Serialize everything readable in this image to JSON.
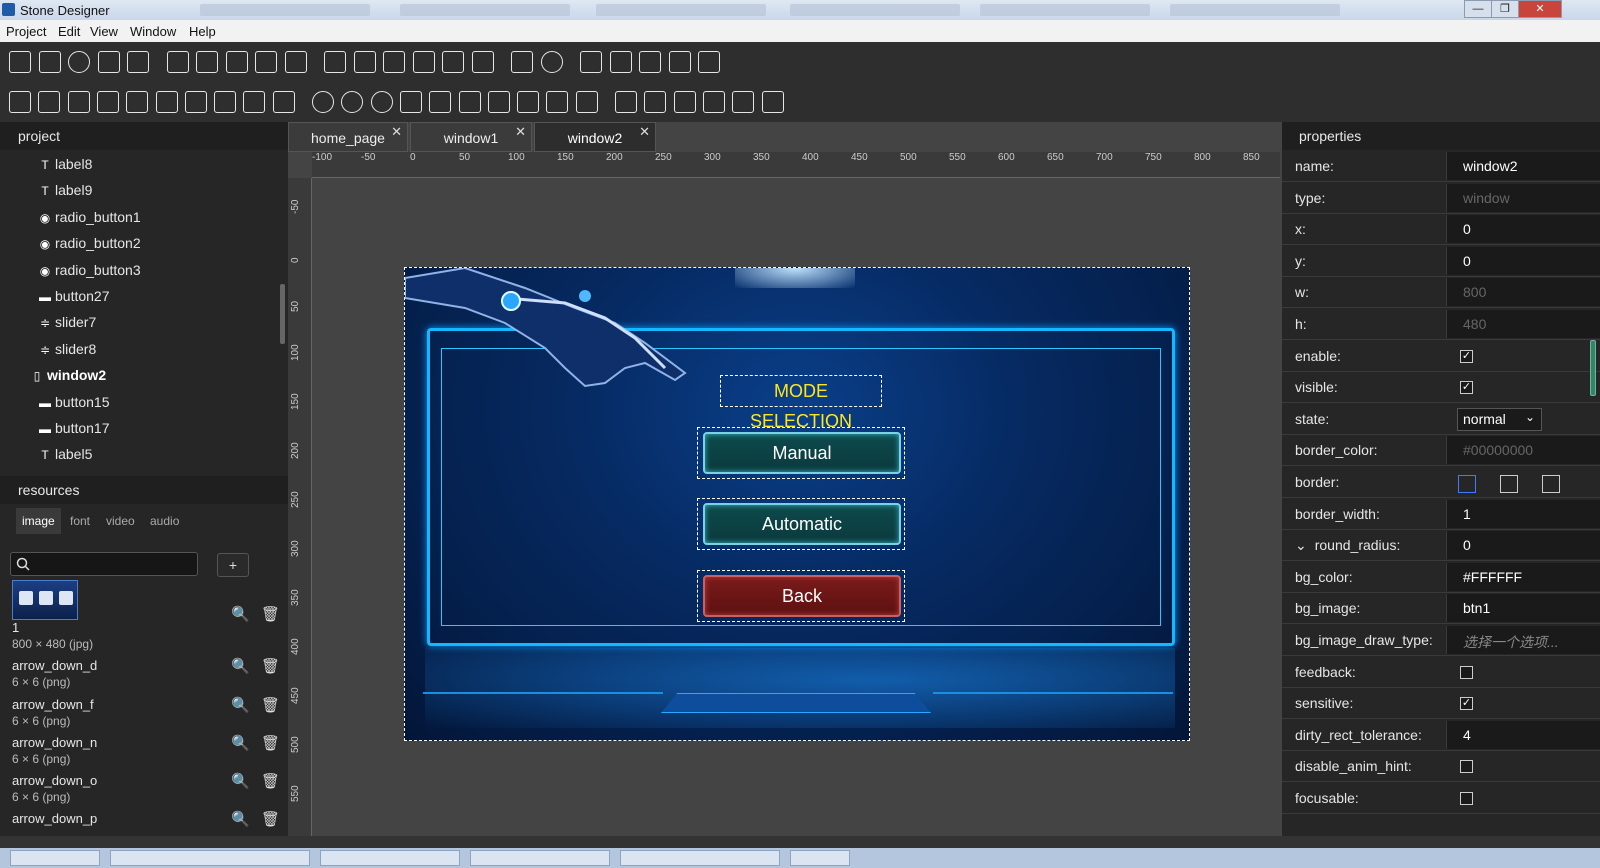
{
  "window": {
    "title": "Stone Designer",
    "close_glyph": "✕",
    "min_glyph": "—",
    "max_glyph": "❐"
  },
  "menu": [
    "Project",
    "Edit",
    "View",
    "Window",
    "Help"
  ],
  "toolbar1_icons": [
    "button-icon",
    "check-icon",
    "radio-icon",
    "switch-icon",
    "list-icon",
    "chart-icon",
    "gif-icon",
    "svg-icon",
    "image-icon",
    "gallery-icon",
    "edit-icon",
    "edit-multi-icon",
    "edit-icon",
    "text-icon",
    "text-icon",
    "text-scale-icon",
    "sliders-icon",
    "progress-circle-icon",
    "keyboard-icon",
    "mixer-icon",
    "download-icon",
    "lock-icon",
    "unlock-icon"
  ],
  "toolbar2_icons": [
    "slider-icon",
    "tab-icon",
    "button-group-icon",
    "list-view-icon",
    "list-icon",
    "ordered-list-icon",
    "combo-icon",
    "monitor-icon",
    "scroll-icon",
    "scrollbar-icon",
    "clock-icon",
    "digit-clock-icon",
    "gauge-icon",
    "thermometer-icon",
    "rows-icon",
    "columns-icon",
    "split-icon",
    "panel-icon",
    "dialog-icon",
    "window-icon",
    "grid-icon",
    "grid-view-icon",
    "crop-icon",
    "move-icon",
    "barcode-icon",
    "qrcode-icon"
  ],
  "project": {
    "header": "project",
    "items": [
      {
        "label": "label8",
        "icon": "T",
        "indent": 1
      },
      {
        "label": "label9",
        "icon": "T",
        "indent": 1
      },
      {
        "label": "radio_button1",
        "icon": "◉",
        "indent": 1
      },
      {
        "label": "radio_button2",
        "icon": "◉",
        "indent": 1
      },
      {
        "label": "radio_button3",
        "icon": "◉",
        "indent": 1
      },
      {
        "label": "button27",
        "icon": "▬",
        "indent": 1
      },
      {
        "label": "slider7",
        "icon": "≑",
        "indent": 1
      },
      {
        "label": "slider8",
        "icon": "≑",
        "indent": 1
      },
      {
        "label": "window2",
        "icon": "▯",
        "indent": 0
      },
      {
        "label": "button15",
        "icon": "▬",
        "indent": 1
      },
      {
        "label": "button17",
        "icon": "▬",
        "indent": 1
      },
      {
        "label": "label5",
        "icon": "T",
        "indent": 1
      }
    ]
  },
  "resources": {
    "header": "resources",
    "tabs": [
      "image",
      "font",
      "video",
      "audio"
    ],
    "active_tab": "image",
    "search_value": "",
    "add_label": "+",
    "list": [
      {
        "name": "1",
        "meta": "800 × 480 (jpg)"
      },
      {
        "name": "arrow_down_d",
        "meta": "6 × 6 (png)"
      },
      {
        "name": "arrow_down_f",
        "meta": "6 × 6 (png)"
      },
      {
        "name": "arrow_down_n",
        "meta": "6 × 6 (png)"
      },
      {
        "name": "arrow_down_o",
        "meta": "6 × 6 (png)"
      },
      {
        "name": "arrow_down_p",
        "meta": ""
      }
    ],
    "zoom_glyph": "🔍",
    "delete_glyph": "🗑"
  },
  "tabs": [
    {
      "label": "home_page",
      "active": false
    },
    {
      "label": "window1",
      "active": false
    },
    {
      "label": "window2",
      "active": true
    }
  ],
  "tab_close": "✕",
  "ruler_top": [
    "-100",
    "-50",
    "0",
    "50",
    "100",
    "150",
    "200",
    "250",
    "300",
    "350",
    "400",
    "450",
    "500",
    "550",
    "600",
    "650",
    "700",
    "750",
    "800",
    "850"
  ],
  "ruler_left": [
    "-50",
    "0",
    "50",
    "100",
    "150",
    "200",
    "250",
    "300",
    "350",
    "400",
    "450",
    "500",
    "550"
  ],
  "stage": {
    "mode_label": "MODE SELECTION",
    "buttons": [
      {
        "label": "Manual",
        "style": "teal"
      },
      {
        "label": "Automatic",
        "style": "teal"
      },
      {
        "label": "Back",
        "style": "red"
      }
    ]
  },
  "properties": {
    "header": "properties",
    "rows": [
      {
        "key": "name:",
        "type": "text",
        "value": "window2"
      },
      {
        "key": "type:",
        "type": "dim",
        "value": "window"
      },
      {
        "key": "x:",
        "type": "text",
        "value": "0"
      },
      {
        "key": "y:",
        "type": "text",
        "value": "0"
      },
      {
        "key": "w:",
        "type": "dim",
        "value": "800"
      },
      {
        "key": "h:",
        "type": "dim",
        "value": "480"
      },
      {
        "key": "enable:",
        "type": "check",
        "value": "✓"
      },
      {
        "key": "visible:",
        "type": "check",
        "value": "✓"
      },
      {
        "key": "state:",
        "type": "select",
        "value": "normal"
      },
      {
        "key": "border_color:",
        "type": "dim",
        "value": "#00000000"
      },
      {
        "key": "border:",
        "type": "border",
        "value": ""
      },
      {
        "key": "border_width:",
        "type": "text",
        "value": "1"
      },
      {
        "key": "round_radius:",
        "type": "text",
        "value": "0",
        "expander": "⌄"
      },
      {
        "key": "bg_color:",
        "type": "text",
        "value": "#FFFFFF"
      },
      {
        "key": "bg_image:",
        "type": "text",
        "value": "btn1"
      },
      {
        "key": "bg_image_draw_type:",
        "type": "placeholder",
        "value": "选择一个选项..."
      },
      {
        "key": "feedback:",
        "type": "check",
        "value": ""
      },
      {
        "key": "sensitive:",
        "type": "check",
        "value": "✓"
      },
      {
        "key": "dirty_rect_tolerance:",
        "type": "text",
        "value": "4"
      },
      {
        "key": "disable_anim_hint:",
        "type": "check",
        "value": ""
      },
      {
        "key": "focusable:",
        "type": "check",
        "value": ""
      }
    ]
  },
  "colors": {
    "accent": "#13b8ff",
    "mode_label": "#ffe81a",
    "back_button": "#7a1a1a",
    "teal_button": "#0d4a4c"
  }
}
